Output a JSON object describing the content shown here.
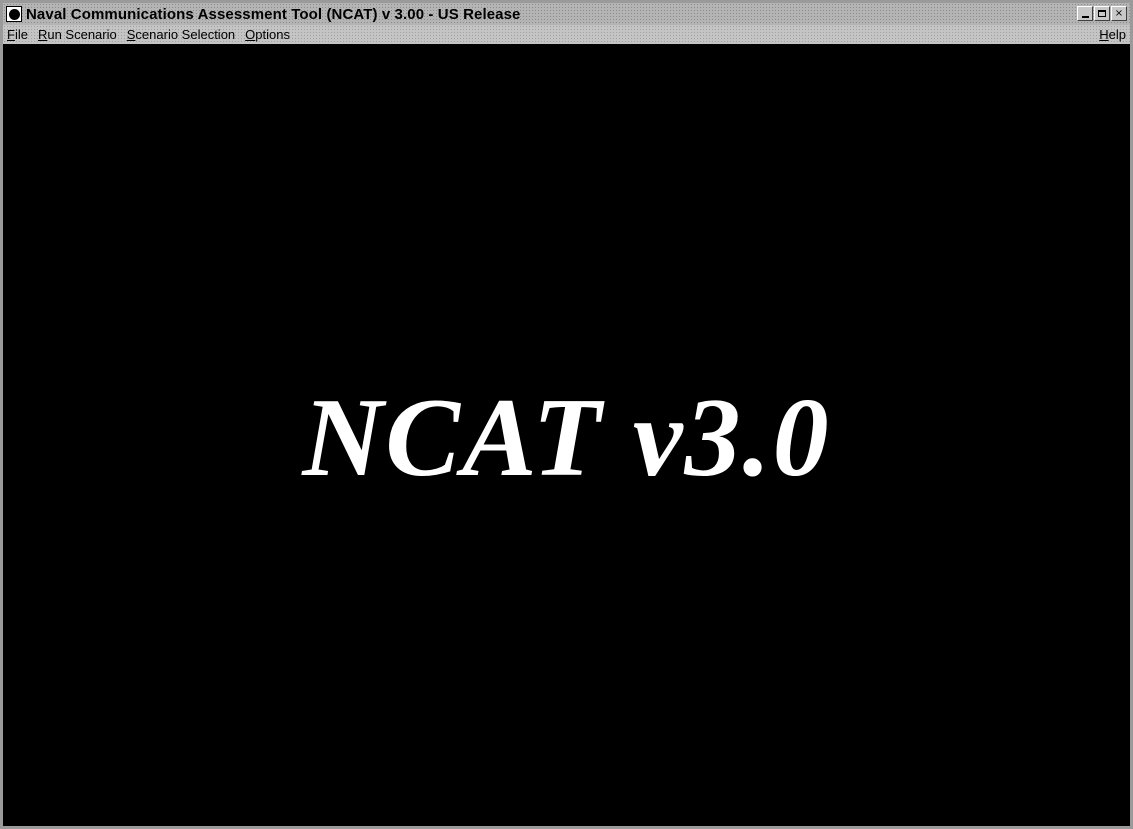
{
  "window": {
    "title": "Naval Communications Assessment Tool (NCAT) v 3.00 - US Release",
    "controls": {
      "minimize_icon": "minimize-icon",
      "maximize_icon": "maximize-icon",
      "close_glyph": "×"
    }
  },
  "menubar": {
    "items": [
      {
        "mnemonic": "F",
        "rest": "ile"
      },
      {
        "mnemonic": "R",
        "rest": "un Scenario"
      },
      {
        "mnemonic": "S",
        "rest": "cenario Selection"
      },
      {
        "mnemonic": "O",
        "rest": "ptions"
      }
    ],
    "help": {
      "mnemonic": "H",
      "rest": "elp"
    }
  },
  "splash": {
    "text": "NCAT v3.0"
  },
  "colors": {
    "client_background": "#000000",
    "splash_text": "#ffffff",
    "chrome": "#c0c0c0"
  }
}
